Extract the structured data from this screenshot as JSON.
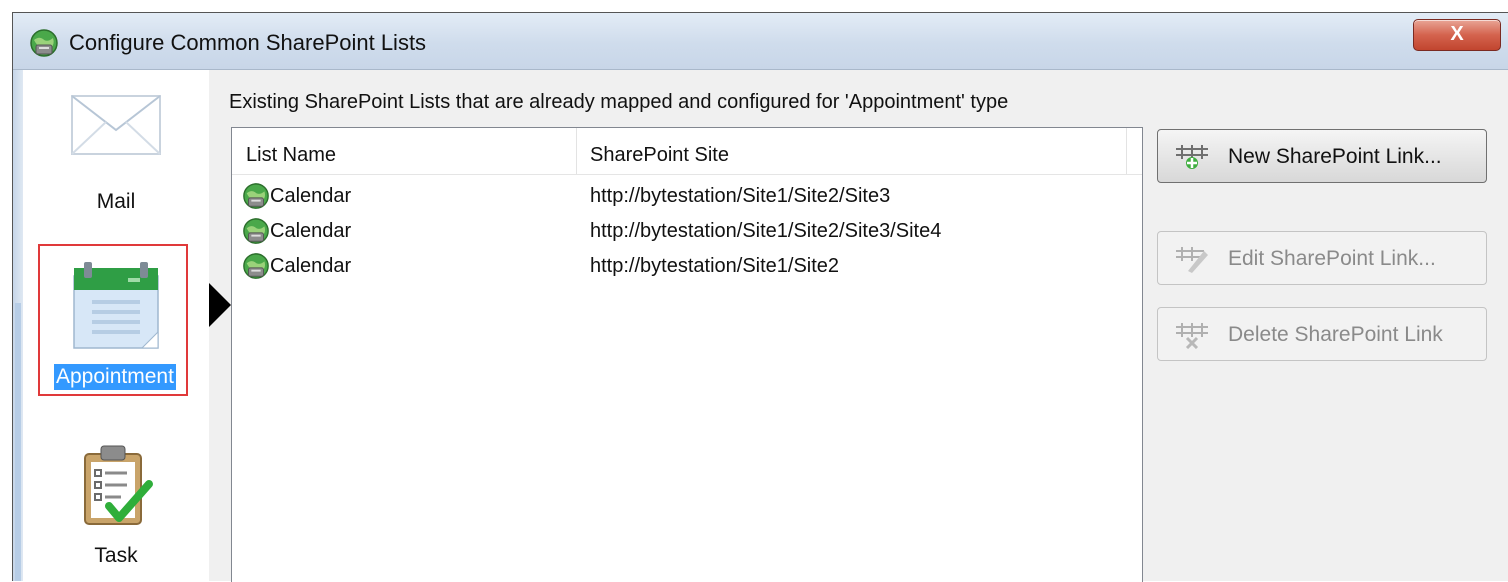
{
  "window": {
    "title": "Configure Common SharePoint Lists",
    "close_label": "X"
  },
  "sidebar": {
    "items": [
      {
        "label": "Mail",
        "selected": false
      },
      {
        "label": "Appointment",
        "selected": true
      },
      {
        "label": "Task",
        "selected": false
      }
    ]
  },
  "main": {
    "caption": "Existing SharePoint Lists that are already mapped and configured for 'Appointment' type",
    "columns": [
      "List Name",
      "SharePoint Site"
    ],
    "rows": [
      {
        "name": "Calendar",
        "site": "http://bytestation/Site1/Site2/Site3"
      },
      {
        "name": "Calendar",
        "site": "http://bytestation/Site1/Site2/Site3/Site4"
      },
      {
        "name": "Calendar",
        "site": "http://bytestation/Site1/Site2"
      }
    ]
  },
  "actions": {
    "new_label": "New SharePoint Link...",
    "edit_label": "Edit SharePoint Link...",
    "delete_label": "Delete SharePoint Link"
  },
  "colors": {
    "selection": "#3399ff",
    "highlight_border": "#e0393a",
    "calendar_green": "#2f9e45"
  }
}
